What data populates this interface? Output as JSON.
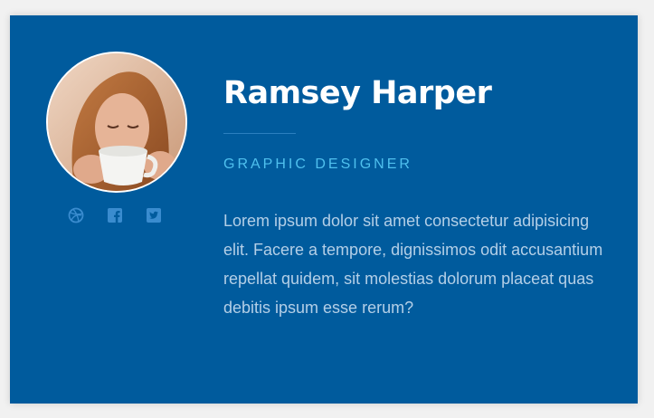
{
  "profile": {
    "name": "Ramsey Harper",
    "role": "GRAPHIC DESIGNER",
    "bio": "Lorem ipsum dolor sit amet consectetur adipisicing elit. Facere a tempore, dignissimos odit accusantium repellat quidem, sit molestias dolorum placeat quas debitis ipsum esse rerum?"
  },
  "socials": [
    {
      "icon": "dribbble-icon"
    },
    {
      "icon": "facebook-icon"
    },
    {
      "icon": "twitter-icon"
    }
  ],
  "colors": {
    "card_background": "#005b9d",
    "page_background": "#f1f1f1",
    "name_text": "#ffffff",
    "role_text": "#4fc0ee",
    "bio_text": "#b3cfe7",
    "divider": "#2b80bf",
    "social_icon": "#3a8ccf"
  }
}
